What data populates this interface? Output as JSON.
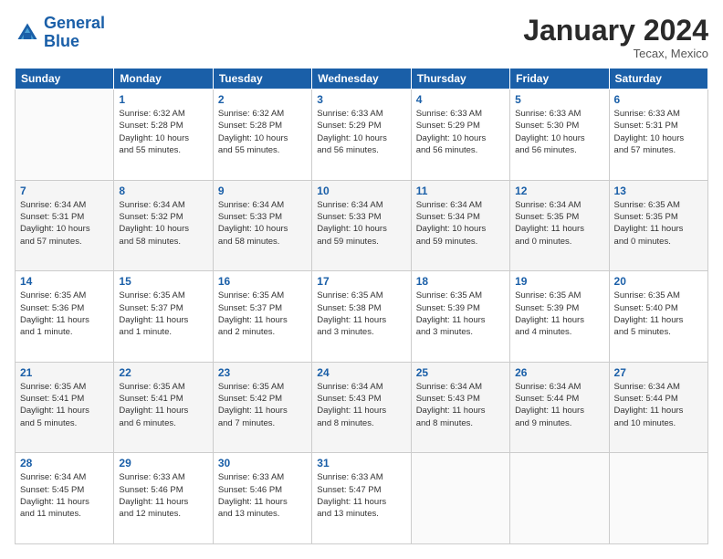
{
  "header": {
    "logo_line1": "General",
    "logo_line2": "Blue",
    "month": "January 2024",
    "location": "Tecax, Mexico"
  },
  "days_of_week": [
    "Sunday",
    "Monday",
    "Tuesday",
    "Wednesday",
    "Thursday",
    "Friday",
    "Saturday"
  ],
  "weeks": [
    [
      {
        "day": "",
        "info": ""
      },
      {
        "day": "1",
        "info": "Sunrise: 6:32 AM\nSunset: 5:28 PM\nDaylight: 10 hours\nand 55 minutes."
      },
      {
        "day": "2",
        "info": "Sunrise: 6:32 AM\nSunset: 5:28 PM\nDaylight: 10 hours\nand 55 minutes."
      },
      {
        "day": "3",
        "info": "Sunrise: 6:33 AM\nSunset: 5:29 PM\nDaylight: 10 hours\nand 56 minutes."
      },
      {
        "day": "4",
        "info": "Sunrise: 6:33 AM\nSunset: 5:29 PM\nDaylight: 10 hours\nand 56 minutes."
      },
      {
        "day": "5",
        "info": "Sunrise: 6:33 AM\nSunset: 5:30 PM\nDaylight: 10 hours\nand 56 minutes."
      },
      {
        "day": "6",
        "info": "Sunrise: 6:33 AM\nSunset: 5:31 PM\nDaylight: 10 hours\nand 57 minutes."
      }
    ],
    [
      {
        "day": "7",
        "info": "Sunrise: 6:34 AM\nSunset: 5:31 PM\nDaylight: 10 hours\nand 57 minutes."
      },
      {
        "day": "8",
        "info": "Sunrise: 6:34 AM\nSunset: 5:32 PM\nDaylight: 10 hours\nand 58 minutes."
      },
      {
        "day": "9",
        "info": "Sunrise: 6:34 AM\nSunset: 5:33 PM\nDaylight: 10 hours\nand 58 minutes."
      },
      {
        "day": "10",
        "info": "Sunrise: 6:34 AM\nSunset: 5:33 PM\nDaylight: 10 hours\nand 59 minutes."
      },
      {
        "day": "11",
        "info": "Sunrise: 6:34 AM\nSunset: 5:34 PM\nDaylight: 10 hours\nand 59 minutes."
      },
      {
        "day": "12",
        "info": "Sunrise: 6:34 AM\nSunset: 5:35 PM\nDaylight: 11 hours\nand 0 minutes."
      },
      {
        "day": "13",
        "info": "Sunrise: 6:35 AM\nSunset: 5:35 PM\nDaylight: 11 hours\nand 0 minutes."
      }
    ],
    [
      {
        "day": "14",
        "info": "Sunrise: 6:35 AM\nSunset: 5:36 PM\nDaylight: 11 hours\nand 1 minute."
      },
      {
        "day": "15",
        "info": "Sunrise: 6:35 AM\nSunset: 5:37 PM\nDaylight: 11 hours\nand 1 minute."
      },
      {
        "day": "16",
        "info": "Sunrise: 6:35 AM\nSunset: 5:37 PM\nDaylight: 11 hours\nand 2 minutes."
      },
      {
        "day": "17",
        "info": "Sunrise: 6:35 AM\nSunset: 5:38 PM\nDaylight: 11 hours\nand 3 minutes."
      },
      {
        "day": "18",
        "info": "Sunrise: 6:35 AM\nSunset: 5:39 PM\nDaylight: 11 hours\nand 3 minutes."
      },
      {
        "day": "19",
        "info": "Sunrise: 6:35 AM\nSunset: 5:39 PM\nDaylight: 11 hours\nand 4 minutes."
      },
      {
        "day": "20",
        "info": "Sunrise: 6:35 AM\nSunset: 5:40 PM\nDaylight: 11 hours\nand 5 minutes."
      }
    ],
    [
      {
        "day": "21",
        "info": "Sunrise: 6:35 AM\nSunset: 5:41 PM\nDaylight: 11 hours\nand 5 minutes."
      },
      {
        "day": "22",
        "info": "Sunrise: 6:35 AM\nSunset: 5:41 PM\nDaylight: 11 hours\nand 6 minutes."
      },
      {
        "day": "23",
        "info": "Sunrise: 6:35 AM\nSunset: 5:42 PM\nDaylight: 11 hours\nand 7 minutes."
      },
      {
        "day": "24",
        "info": "Sunrise: 6:34 AM\nSunset: 5:43 PM\nDaylight: 11 hours\nand 8 minutes."
      },
      {
        "day": "25",
        "info": "Sunrise: 6:34 AM\nSunset: 5:43 PM\nDaylight: 11 hours\nand 8 minutes."
      },
      {
        "day": "26",
        "info": "Sunrise: 6:34 AM\nSunset: 5:44 PM\nDaylight: 11 hours\nand 9 minutes."
      },
      {
        "day": "27",
        "info": "Sunrise: 6:34 AM\nSunset: 5:44 PM\nDaylight: 11 hours\nand 10 minutes."
      }
    ],
    [
      {
        "day": "28",
        "info": "Sunrise: 6:34 AM\nSunset: 5:45 PM\nDaylight: 11 hours\nand 11 minutes."
      },
      {
        "day": "29",
        "info": "Sunrise: 6:33 AM\nSunset: 5:46 PM\nDaylight: 11 hours\nand 12 minutes."
      },
      {
        "day": "30",
        "info": "Sunrise: 6:33 AM\nSunset: 5:46 PM\nDaylight: 11 hours\nand 13 minutes."
      },
      {
        "day": "31",
        "info": "Sunrise: 6:33 AM\nSunset: 5:47 PM\nDaylight: 11 hours\nand 13 minutes."
      },
      {
        "day": "",
        "info": ""
      },
      {
        "day": "",
        "info": ""
      },
      {
        "day": "",
        "info": ""
      }
    ]
  ]
}
